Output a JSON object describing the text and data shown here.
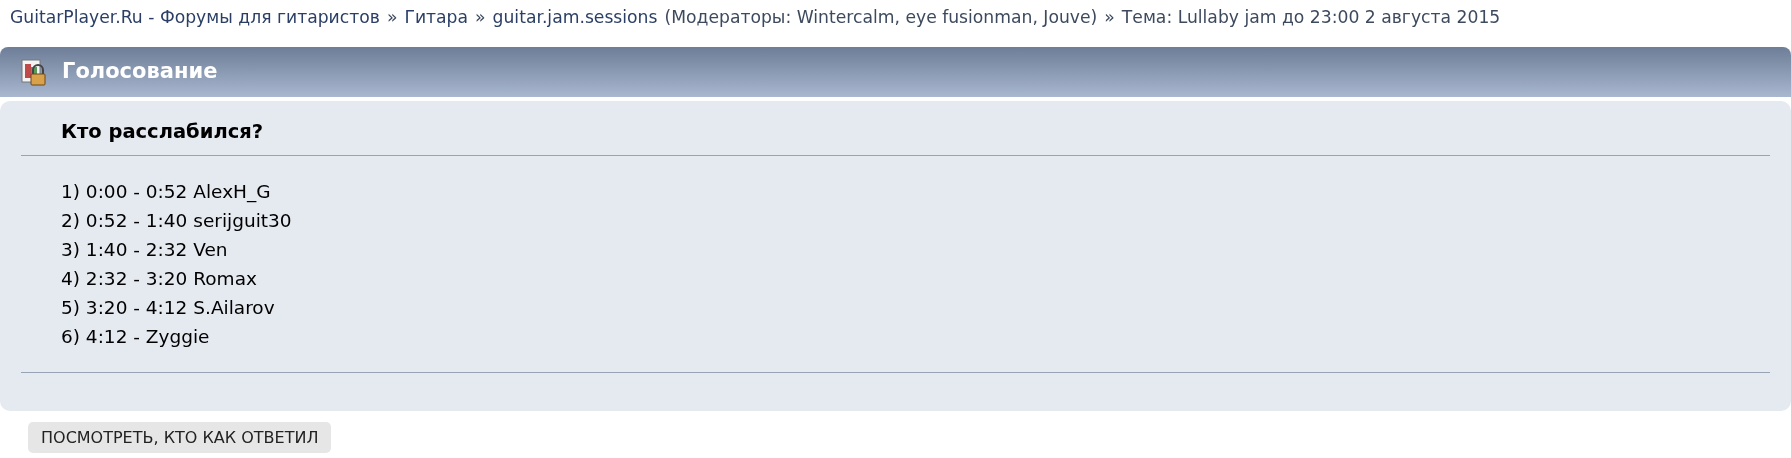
{
  "breadcrumb": [
    {
      "kind": "link",
      "text": "GuitarPlayer.Ru - Форумы для гитаристов"
    },
    {
      "kind": "separator",
      "text": "»"
    },
    {
      "kind": "link",
      "text": "Гитара"
    },
    {
      "kind": "separator",
      "text": "»"
    },
    {
      "kind": "link",
      "text": "guitar.jam.sessions"
    },
    {
      "kind": "text",
      "text": "(Модераторы: Wintercalm, eye fusionman, Jouve)"
    },
    {
      "kind": "separator",
      "text": "»"
    },
    {
      "kind": "text",
      "text": "Тема: Lullaby jam до 23:00 2 августа 2015"
    }
  ],
  "poll": {
    "title": "Голосование",
    "question": "Кто расслабился?",
    "options": [
      "1) 0:00 - 0:52 AlexH_G",
      "2) 0:52 - 1:40 serijguit30",
      "3) 1:40 - 2:32 Ven",
      "4) 2:32 - 3:20 Romax",
      "5) 3:20 - 4:12 S.Ailarov",
      "6) 4:12 - Zyggie"
    ],
    "button": "ПОСМОТРЕТЬ, КТО КАК ОТВЕТИЛ"
  }
}
